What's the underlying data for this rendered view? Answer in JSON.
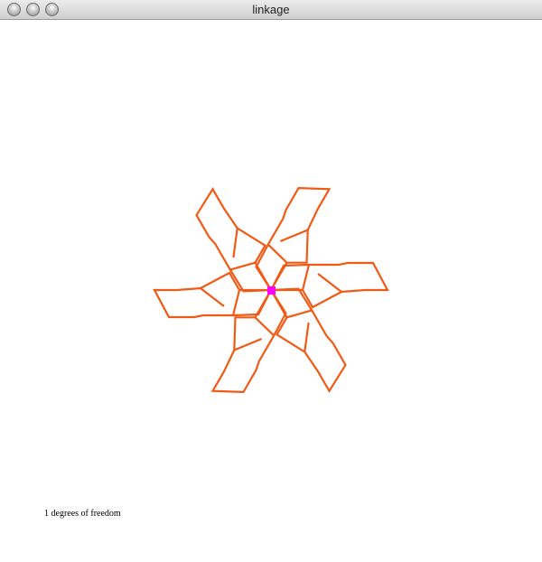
{
  "window": {
    "title": "linkage",
    "controls": [
      "close-button",
      "minimize-button",
      "zoom-button"
    ]
  },
  "status": {
    "text": "1 degrees of freedom"
  },
  "colors": {
    "link": "#f05a14",
    "pivot": "#ff00ff",
    "background": "#ffffff"
  }
}
